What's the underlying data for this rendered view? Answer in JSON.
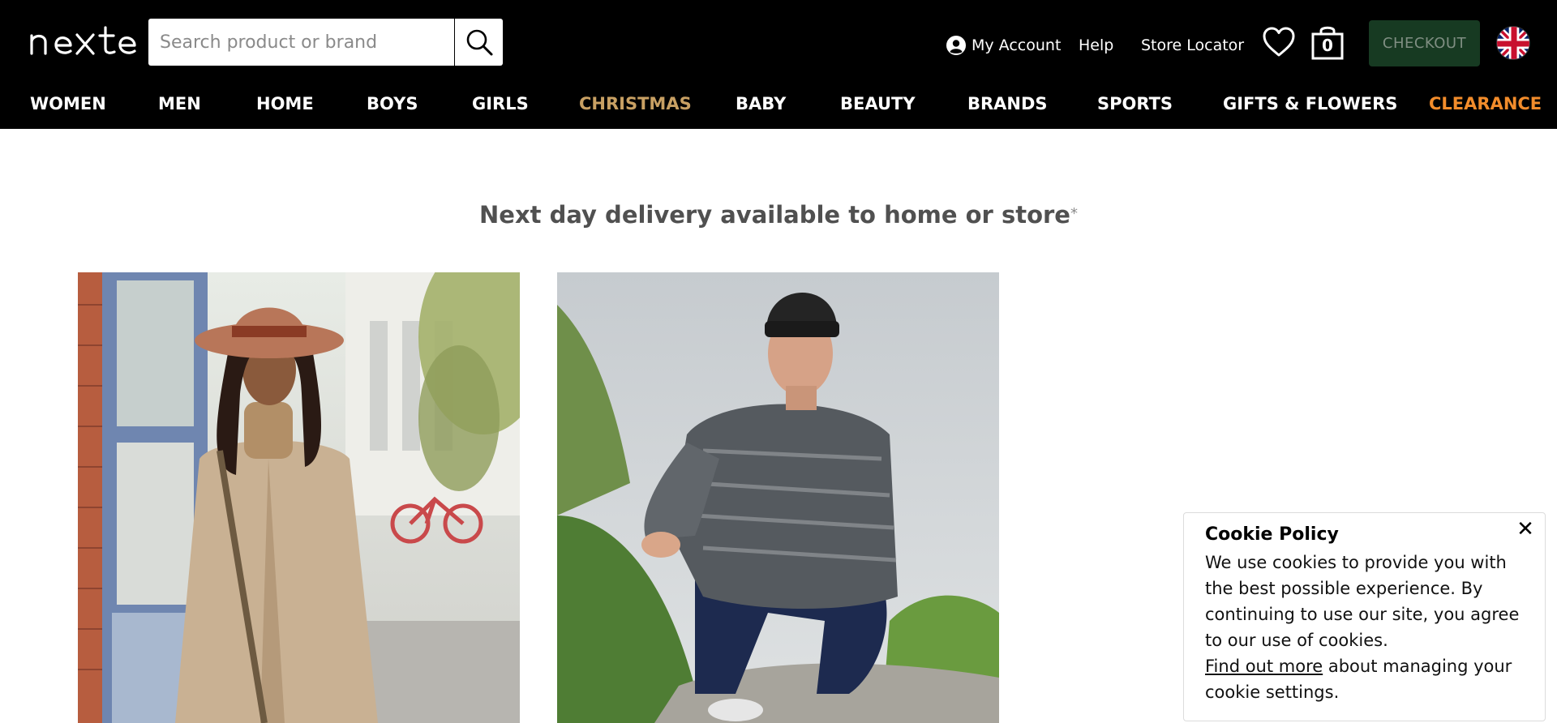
{
  "header": {
    "logo_text": "next",
    "search": {
      "placeholder": "Search product or brand",
      "value": ""
    },
    "utility_links": [
      "My Account",
      "Help",
      "Store Locator"
    ],
    "bag_count": "0",
    "checkout_label": "CHECKOUT",
    "icons": [
      "search-icon",
      "account-icon",
      "heart-icon",
      "bag-icon",
      "uk-flag-icon"
    ]
  },
  "nav": {
    "items": [
      {
        "label": "WOMEN",
        "color": "#ffffff"
      },
      {
        "label": "MEN",
        "color": "#ffffff"
      },
      {
        "label": "HOME",
        "color": "#ffffff"
      },
      {
        "label": "BOYS",
        "color": "#ffffff"
      },
      {
        "label": "GIRLS",
        "color": "#ffffff"
      },
      {
        "label": "CHRISTMAS",
        "color": "#c8a063"
      },
      {
        "label": "BABY",
        "color": "#ffffff"
      },
      {
        "label": "BEAUTY",
        "color": "#ffffff"
      },
      {
        "label": "BRANDS",
        "color": "#ffffff"
      },
      {
        "label": "SPORTS",
        "color": "#ffffff"
      },
      {
        "label": "GIFTS & FLOWERS",
        "color": "#ffffff"
      },
      {
        "label": "CLEARANCE",
        "color": "#f28c2b"
      }
    ]
  },
  "main": {
    "headline": "Next day delivery available to home or store",
    "headline_mark": "*",
    "promos": [
      "women-promo-image",
      "men-promo-image"
    ]
  },
  "cookie_banner": {
    "title": "Cookie Policy",
    "body": "We use cookies to provide you with the best possible experience. By continuing to use our site, you agree to our use of cookies.",
    "link_text": "Find out more",
    "link_suffix": " about managing your cookie settings.",
    "close_glyph": "✕"
  },
  "colors": {
    "header_bg": "#000000",
    "checkout_bg": "#173a22",
    "christmas": "#c8a063",
    "clearance": "#f28c2b",
    "headline": "#505050"
  }
}
